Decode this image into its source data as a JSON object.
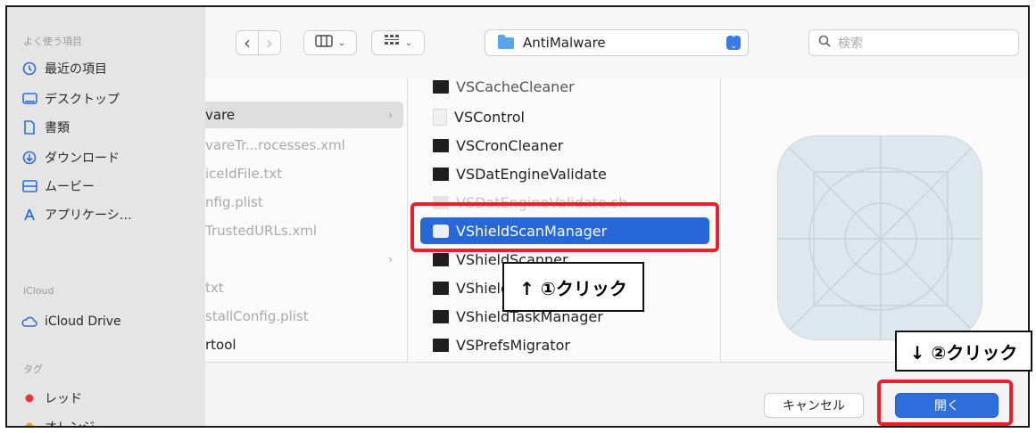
{
  "sidebar": {
    "favorites_header": "よく使う項目",
    "favorites": [
      {
        "label": "最近の項目",
        "icon": "clock-icon"
      },
      {
        "label": "デスクトップ",
        "icon": "desktop-icon"
      },
      {
        "label": "書類",
        "icon": "document-icon"
      },
      {
        "label": "ダウンロード",
        "icon": "download-icon"
      },
      {
        "label": "ムービー",
        "icon": "movie-icon"
      },
      {
        "label": "アプリケーシ…",
        "icon": "apps-icon"
      }
    ],
    "icloud_header": "iCloud",
    "icloud": [
      {
        "label": "iCloud Drive",
        "icon": "cloud-icon"
      }
    ],
    "tags_header": "タグ",
    "tags": [
      {
        "label": "レッド",
        "color": "#e8333b"
      },
      {
        "label": "オレンジ",
        "color": "#f09a2a"
      }
    ]
  },
  "toolbar": {
    "back": "‹",
    "forward": "›",
    "view_icon": "columns-view-icon",
    "group_icon": "grid-group-icon",
    "location": "AntiMalware",
    "search_placeholder": "検索"
  },
  "column1": {
    "items": [
      {
        "label": "vare",
        "selected": true,
        "chevron": true
      },
      {
        "label": "vareTr...rocesses.xml"
      },
      {
        "label": "iceIdFile.txt"
      },
      {
        "label": "nfig.plist"
      },
      {
        "label": "TrustedURLs.xml"
      },
      {
        "label": "",
        "chevron": true
      },
      {
        "label": "txt"
      },
      {
        "label": "stallConfig.plist"
      },
      {
        "label": "rtool",
        "dark": true
      }
    ]
  },
  "column2": {
    "items": [
      {
        "label": "VSCacheCleaner",
        "partial": true
      },
      {
        "label": "VSControl",
        "kind": "doc"
      },
      {
        "label": "VSCronCleaner"
      },
      {
        "label": "VSDatEngineValidate"
      },
      {
        "label": "VSDatEngineValidate.sh",
        "dim": true
      },
      {
        "label": "VShieldScanManager",
        "selected": true
      },
      {
        "label": "VShieldScanner"
      },
      {
        "label": "VShieldService"
      },
      {
        "label": "VShieldTaskManager"
      },
      {
        "label": "VSPrefsMigrator"
      }
    ]
  },
  "buttons": {
    "cancel": "キャンセル",
    "open": "開く"
  },
  "annotations": {
    "step1": "↑ ①クリック",
    "step2": "↓ ②クリック",
    "highlight_color": "#e8202a"
  }
}
